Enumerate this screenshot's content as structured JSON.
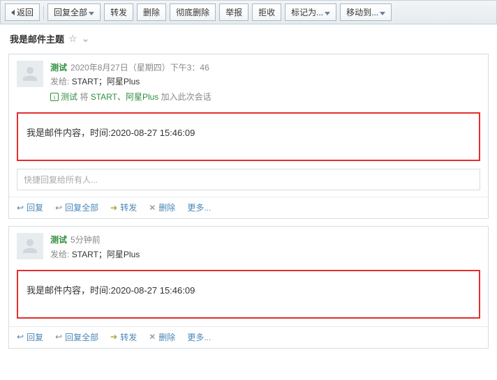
{
  "toolbar": {
    "back": "返回",
    "reply_all": "回复全部",
    "forward": "转发",
    "delete": "删除",
    "perm_delete": "彻底删除",
    "report": "举报",
    "reject": "拒收",
    "mark_as": "标记为...",
    "move_to": "移动到..."
  },
  "subject": "我是邮件主题",
  "quick_reply_placeholder": "快捷回复给所有人...",
  "actions": {
    "reply": "回复",
    "reply_all": "回复全部",
    "forward": "转发",
    "delete": "删除",
    "more": "更多..."
  },
  "messages": [
    {
      "sender": "测试",
      "datetime": "2020年8月27日（星期四）下午3：46",
      "recipients_label": "发给:",
      "recipients": "START；阿星Plus",
      "join_pre": "测试",
      "join_mid": "将",
      "join_names": "START、阿星Plus",
      "join_suf": "加入此次会话",
      "body": "我是邮件内容，时间:2020-08-27 15:46:09",
      "show_join": true,
      "show_quick_reply": true
    },
    {
      "sender": "测试",
      "datetime": "5分钟前",
      "recipients_label": "发给:",
      "recipients": "START；阿星Plus",
      "body": "我是邮件内容，时间:2020-08-27 15:46:09",
      "show_join": false,
      "show_quick_reply": false
    }
  ]
}
